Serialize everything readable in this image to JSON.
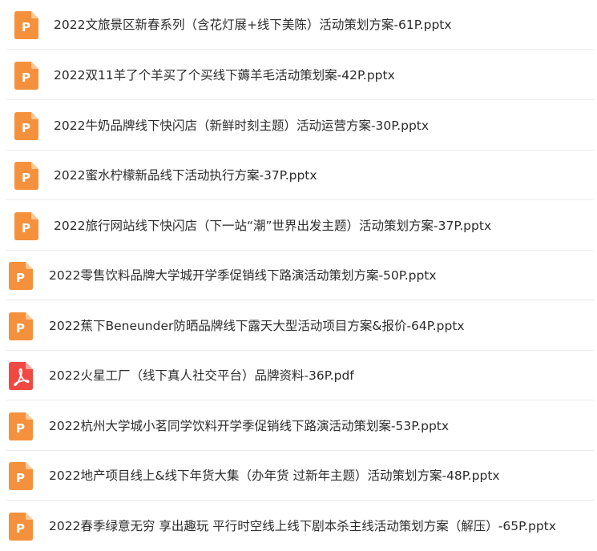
{
  "files": [
    {
      "name": "2022文旅景区新春系列（含花灯展+线下美陈）活动策划方案-61P.pptx",
      "type": "pptx",
      "icon": "ppt-file-icon"
    },
    {
      "name": "2022双11羊了个羊买了个买线下薅羊毛活动策划案-42P.pptx",
      "type": "pptx",
      "icon": "ppt-file-icon"
    },
    {
      "name": "2022牛奶品牌线下快闪店（新鲜时刻主题）活动运营方案-30P.pptx",
      "type": "pptx",
      "icon": "ppt-file-icon"
    },
    {
      "name": "2022蜜水柠檬新品线下活动执行方案-37P.pptx",
      "type": "pptx",
      "icon": "ppt-file-icon"
    },
    {
      "name": "2022旅行网站线下快闪店（下一站“潮”世界出发主题）活动策划方案-37P.pptx",
      "type": "pptx",
      "icon": "ppt-file-icon"
    },
    {
      "name": "2022零售饮料品牌大学城开学季促销线下路演活动策划方案-50P.pptx",
      "type": "pptx",
      "icon": "ppt-file-icon"
    },
    {
      "name": "2022蕉下Beneunder防晒品牌线下露天大型活动项目方案&报价-64P.pptx",
      "type": "pptx",
      "icon": "ppt-file-icon"
    },
    {
      "name": "2022火星工厂（线下真人社交平台）品牌资料-36P.pdf",
      "type": "pdf",
      "icon": "pdf-file-icon"
    },
    {
      "name": "2022杭州大学城小茗同学饮料开学季促销线下路演活动策划案-53P.pptx",
      "type": "pptx",
      "icon": "ppt-file-icon"
    },
    {
      "name": "2022地产项目线上&线下年货大集（办年货 过新年主题）活动策划方案-48P.pptx",
      "type": "pptx",
      "icon": "ppt-file-icon"
    },
    {
      "name": "2022春季绿意无穷 享出趣玩 平行时空线上线下剧本杀主线活动策划方案（解压）-65P.pptx",
      "type": "pptx",
      "icon": "ppt-file-icon"
    }
  ],
  "colors": {
    "pptx": "#f5913c",
    "pptx_fold": "#fbc795",
    "pdf": "#ee4a43",
    "pdf_fold": "#f7a39f"
  }
}
